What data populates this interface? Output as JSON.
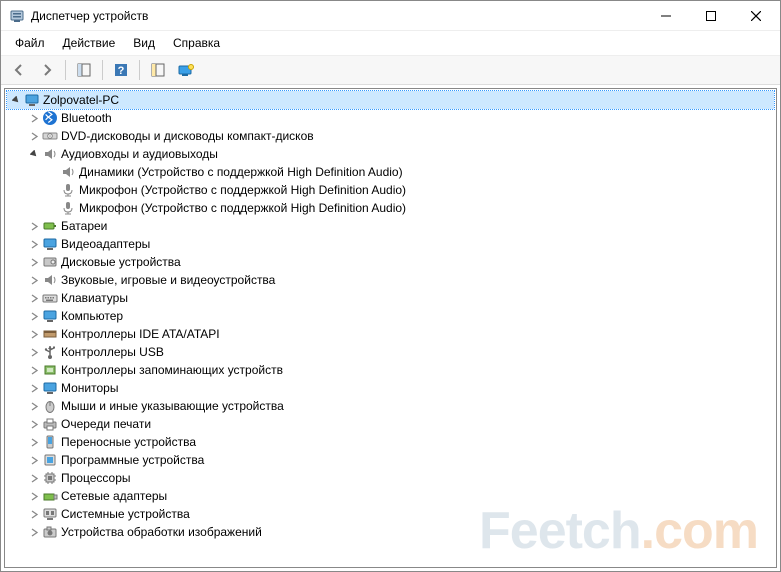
{
  "window": {
    "title": "Диспетчер устройств"
  },
  "menu": {
    "file": "Файл",
    "action": "Действие",
    "view": "Вид",
    "help": "Справка"
  },
  "tree": {
    "root": {
      "label": "Zolpovatel-PC",
      "selected": true,
      "expanded": true
    },
    "bluetooth": {
      "label": "Bluetooth"
    },
    "dvd": {
      "label": "DVD-дисководы и дисководы компакт-дисков"
    },
    "audio": {
      "label": "Аудиовходы и аудиовыходы",
      "expanded": true,
      "children": {
        "spk": "Динамики (Устройство с поддержкой High Definition Audio)",
        "mic1": "Микрофон (Устройство с поддержкой High Definition Audio)",
        "mic2": "Микрофон (Устройство с поддержкой High Definition Audio)"
      }
    },
    "battery": {
      "label": "Батареи"
    },
    "video": {
      "label": "Видеоадаптеры"
    },
    "disk": {
      "label": "Дисковые устройства"
    },
    "sound_game": {
      "label": "Звуковые, игровые и видеоустройства"
    },
    "keyboard": {
      "label": "Клавиатуры"
    },
    "computer": {
      "label": "Компьютер"
    },
    "ide": {
      "label": "Контроллеры IDE ATA/ATAPI"
    },
    "usb": {
      "label": "Контроллеры USB"
    },
    "storage_ctrl": {
      "label": "Контроллеры запоминающих устройств"
    },
    "monitor": {
      "label": "Мониторы"
    },
    "mouse": {
      "label": "Мыши и иные указывающие устройства"
    },
    "print_queue": {
      "label": "Очереди печати"
    },
    "portable": {
      "label": "Переносные устройства"
    },
    "software_dev": {
      "label": "Программные устройства"
    },
    "cpu": {
      "label": "Процессоры"
    },
    "network": {
      "label": "Сетевые адаптеры"
    },
    "system_dev": {
      "label": "Системные устройства"
    },
    "imaging": {
      "label": "Устройства обработки изображений"
    }
  },
  "watermark": {
    "part1": "Feetch",
    "part2": ".com"
  }
}
